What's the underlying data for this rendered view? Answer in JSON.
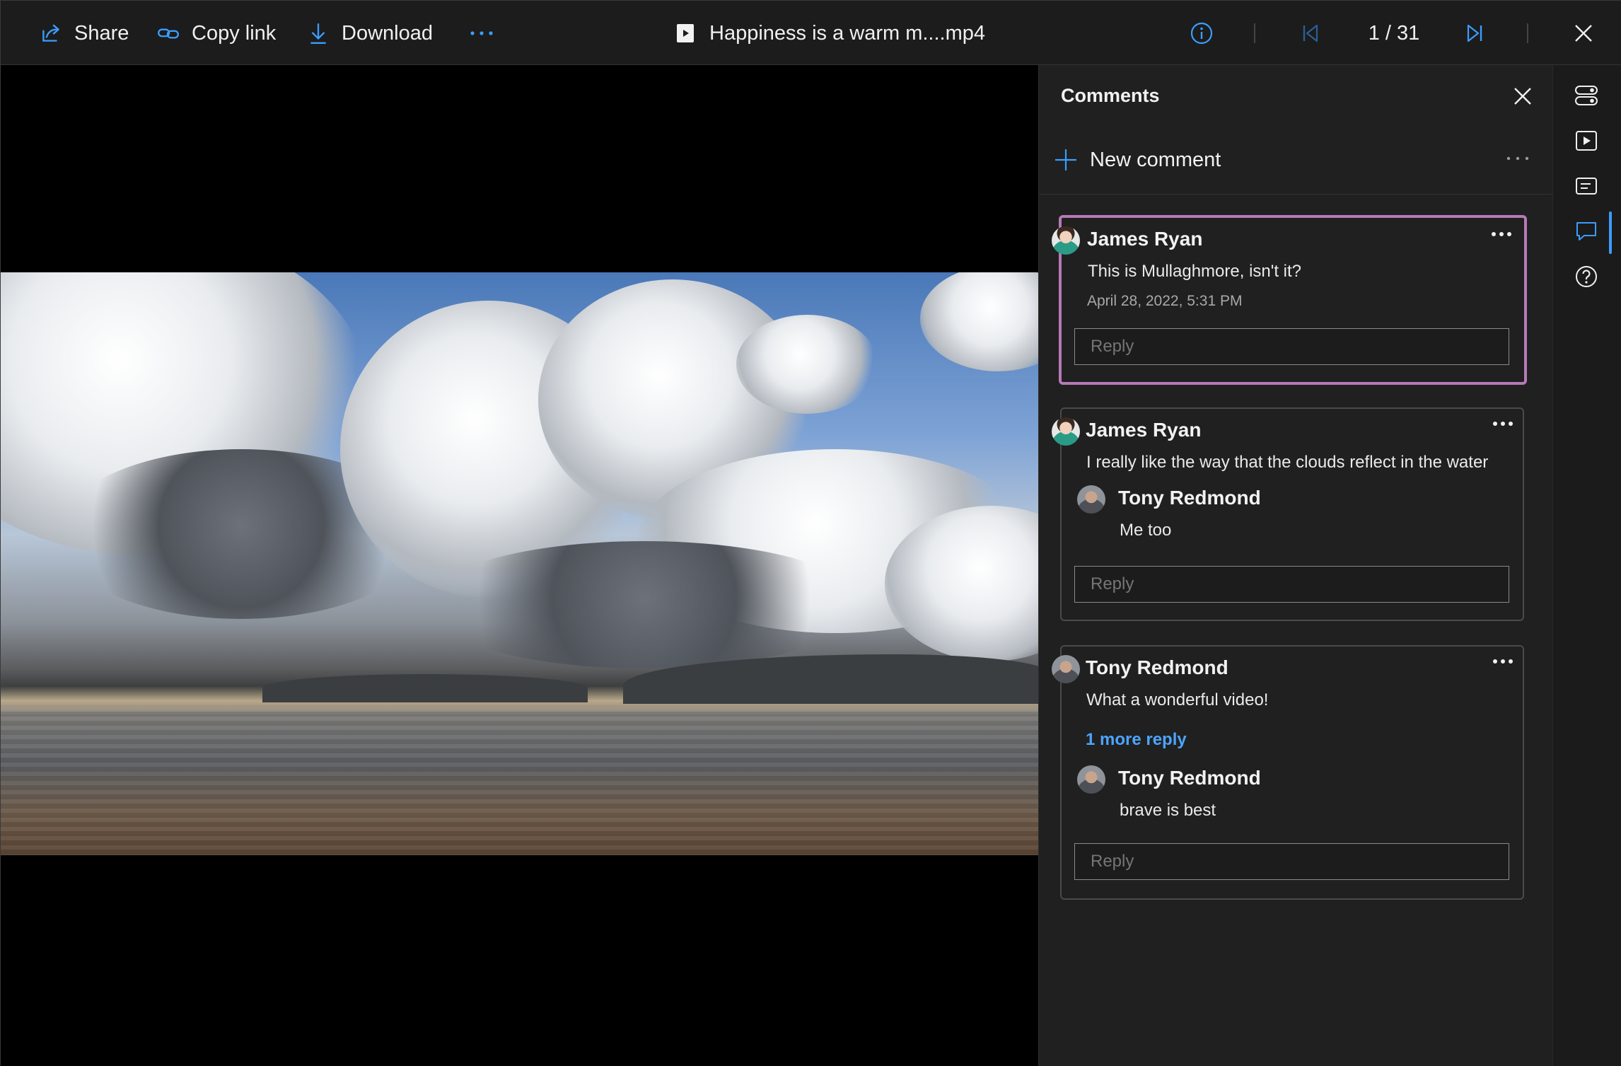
{
  "toolbar": {
    "share_label": "Share",
    "copy_link_label": "Copy link",
    "download_label": "Download",
    "file_name": "Happiness is a warm m....mp4",
    "pager": "1 / 31"
  },
  "comments_pane": {
    "title": "Comments",
    "new_comment_label": "New comment",
    "threads": [
      {
        "author": "James Ryan",
        "text": "This is Mullaghmore, isn't it?",
        "timestamp": "April 28, 2022, 5:31 PM",
        "reply_placeholder": "Reply",
        "selected": true
      },
      {
        "author": "James Ryan",
        "text": "I really like the way that the clouds reflect in the water",
        "replies": [
          {
            "author": "Tony Redmond",
            "text": "Me too"
          }
        ],
        "reply_placeholder": "Reply"
      },
      {
        "author": "Tony Redmond",
        "text": "What a wonderful video!",
        "more_replies_label": "1 more reply",
        "replies": [
          {
            "author": "Tony Redmond",
            "text": "brave is best"
          }
        ],
        "reply_placeholder": "Reply"
      }
    ]
  },
  "colors": {
    "accent": "#4ca4ff",
    "selected_border": "#b57ab7",
    "pane_bg": "#202020",
    "toolbar_bg": "#1c1c1c"
  },
  "icons": {
    "toolbar": [
      "share-icon",
      "link-icon",
      "download-icon",
      "more-icon",
      "video-file-icon",
      "info-icon",
      "first-item-icon",
      "last-item-icon",
      "close-icon"
    ],
    "rail": [
      "toggle-icon",
      "play-icon",
      "transcript-icon",
      "comment-icon",
      "help-icon"
    ]
  }
}
